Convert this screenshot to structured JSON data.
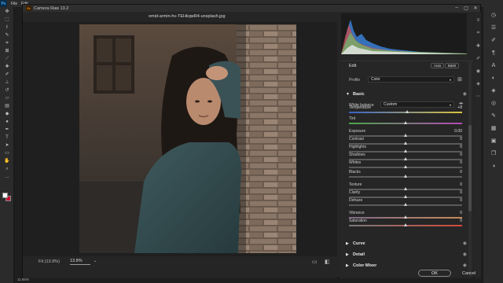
{
  "photoshop": {
    "logo": "Ps",
    "menus": [
      "File",
      "Edit"
    ],
    "zoom_level": "11.66%",
    "tools": [
      "move-tool",
      "marquee-tool",
      "lasso-tool",
      "quick-select-tool",
      "crop-tool",
      "frame-tool",
      "eyedropper-tool",
      "healing-tool",
      "brush-tool",
      "stamp-tool",
      "history-brush-tool",
      "eraser-tool",
      "gradient-tool",
      "blur-tool",
      "dodge-tool",
      "pen-tool",
      "type-tool",
      "path-select-tool",
      "shape-tool",
      "hand-tool",
      "zoom-tool",
      "more-tool"
    ],
    "right_icons": [
      "history-icon",
      "properties-icon",
      "brush-settings-icon",
      "paragraph-icon",
      "character-icon",
      "adjustments-icon",
      "layers-icon",
      "channels-icon",
      "paths-icon",
      "swatches-icon",
      "libraries-icon"
    ]
  },
  "camera_raw": {
    "title": "Camera Raw 13.2",
    "filename": "omid-armin-hv-TEHkqwR4-unsplash.jpg",
    "bottom": {
      "fit_label": "Fit (13.9%)",
      "zoom_value": "13.8%"
    },
    "panel": {
      "edit_label": "Edit",
      "auto_label": "Auto",
      "bw_label": "B&W",
      "profile_label": "Profile",
      "profile_value": "Color",
      "basic_label": "Basic",
      "white_balance_label": "White balance",
      "white_balance_value": "Custom",
      "sliders": [
        {
          "label": "Temperature",
          "value": "+8",
          "pos": 0.52
        },
        {
          "label": "Tint",
          "value": "",
          "pos": 0.5
        },
        {
          "label": "Exposure",
          "value": "0.00",
          "pos": 0.5
        },
        {
          "label": "Contrast",
          "value": "0",
          "pos": 0.5
        },
        {
          "label": "Highlights",
          "value": "0",
          "pos": 0.5
        },
        {
          "label": "Shadows",
          "value": "0",
          "pos": 0.5
        },
        {
          "label": "Whites",
          "value": "0",
          "pos": 0.5
        },
        {
          "label": "Blacks",
          "value": "0",
          "pos": 0.5
        },
        {
          "label": "Texture",
          "value": "0",
          "pos": 0.5
        },
        {
          "label": "Clarity",
          "value": "0",
          "pos": 0.5
        },
        {
          "label": "Dehaze",
          "value": "0",
          "pos": 0.5
        },
        {
          "label": "Vibrance",
          "value": "0",
          "pos": 0.5
        },
        {
          "label": "Saturation",
          "value": "0",
          "pos": 0.5
        }
      ],
      "sections": [
        "Curve",
        "Detail",
        "Color Mixer"
      ]
    },
    "ok_label": "OK",
    "cancel_label": "Cancel"
  }
}
